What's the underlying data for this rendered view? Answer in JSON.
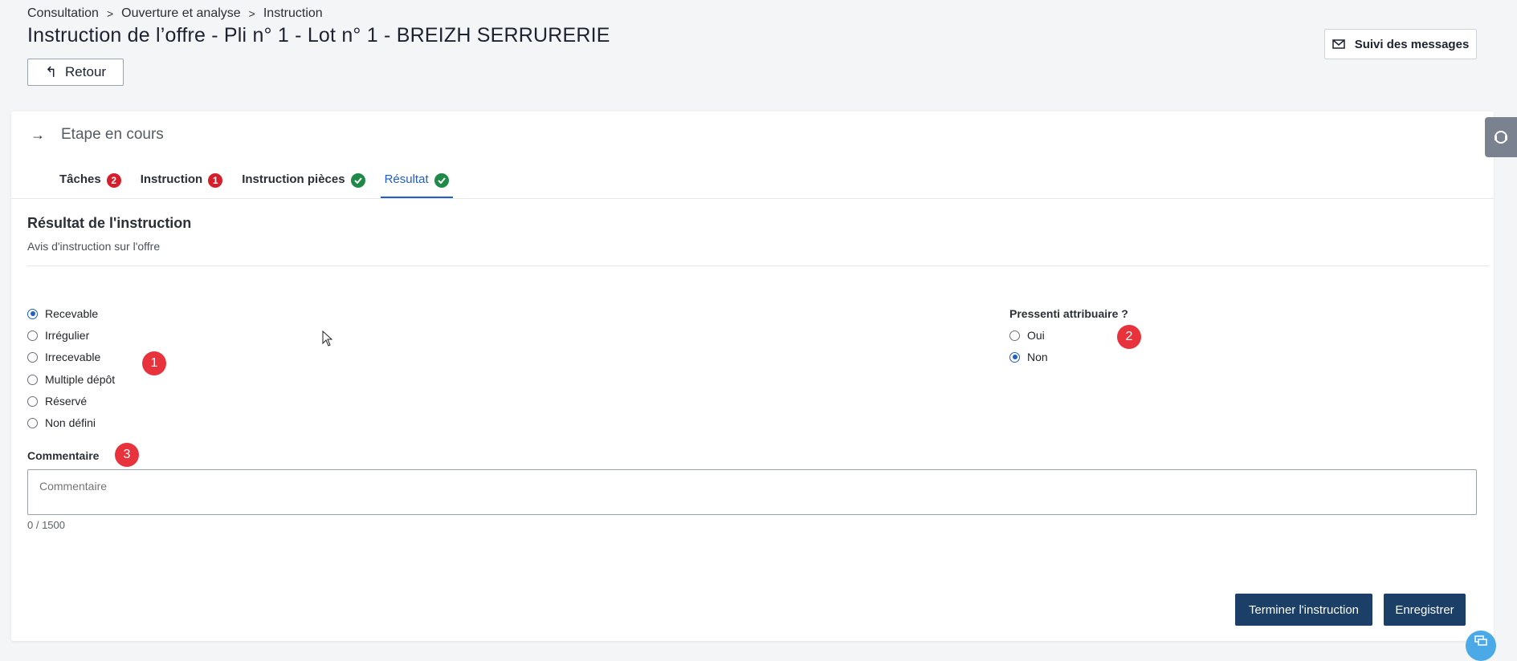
{
  "breadcrumb": {
    "items": [
      "Consultation",
      "Ouverture et analyse",
      "Instruction"
    ],
    "separator": ">"
  },
  "page_title": "Instruction de l’offre - Pli n° 1 - Lot n° 1 - BREIZH SERRURERIE",
  "back_button": {
    "label": "Retour",
    "icon": "undo-arrow-icon"
  },
  "messages_button": {
    "label": "Suivi des messages",
    "icon": "envelope-icon"
  },
  "step": {
    "label": "Etape en cours",
    "icon": "arrow-right-icon"
  },
  "tabs": [
    {
      "label": "Tâches",
      "badge": "2",
      "status": "count"
    },
    {
      "label": "Instruction",
      "badge": "1",
      "status": "count"
    },
    {
      "label": "Instruction pièces",
      "status": "done"
    },
    {
      "label": "Résultat",
      "status": "done",
      "active": true
    }
  ],
  "section": {
    "title": "Résultat de l'instruction",
    "subtitle": "Avis d'instruction sur l'offre"
  },
  "avis_options": [
    {
      "label": "Recevable",
      "checked": true
    },
    {
      "label": "Irrégulier",
      "checked": false
    },
    {
      "label": "Irrecevable",
      "checked": false
    },
    {
      "label": "Multiple dépôt",
      "checked": false
    },
    {
      "label": "Réservé",
      "checked": false
    },
    {
      "label": "Non défini",
      "checked": false
    }
  ],
  "attributaire": {
    "label": "Pressenti attribuaire ?",
    "options": [
      {
        "label": "Oui",
        "checked": false
      },
      {
        "label": "Non",
        "checked": true
      }
    ]
  },
  "comment": {
    "label": "Commentaire",
    "placeholder": "Commentaire",
    "value": "",
    "counter": "0 / 1500"
  },
  "markers": [
    "1",
    "2",
    "3"
  ],
  "actions": {
    "finish_label": "Terminer l'instruction",
    "save_label": "Enregistrer"
  },
  "colors": {
    "primary": "#1b3f66",
    "link": "#1f5fc7",
    "badge_red": "#d71e2b",
    "success_green": "#1f8a48",
    "marker_red": "#e8323c"
  }
}
